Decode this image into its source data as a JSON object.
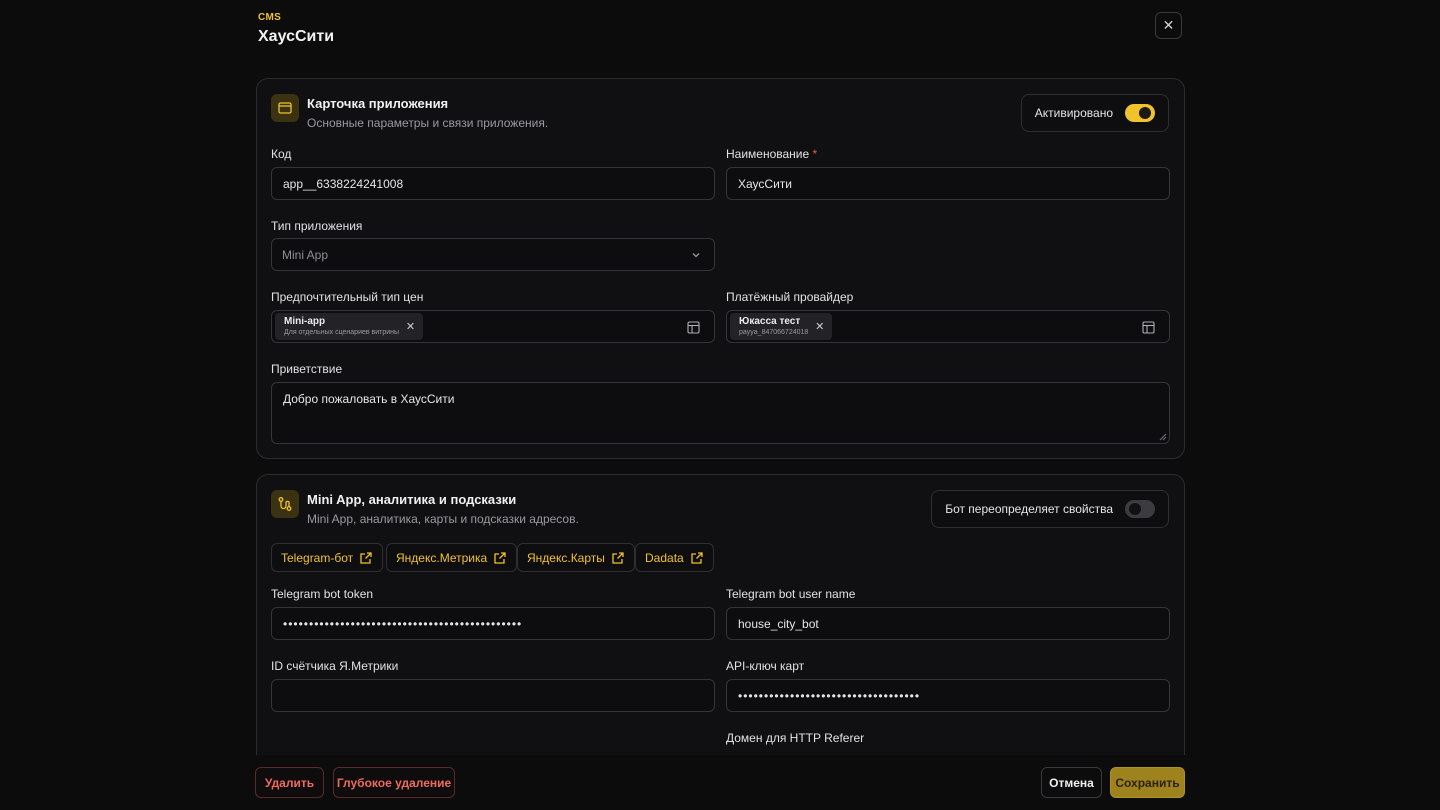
{
  "header": {
    "eyebrow": "CMS",
    "title": "ХаусСити"
  },
  "card1": {
    "title": "Карточка приложения",
    "subtitle": "Основные параметры и связи приложения.",
    "toggle_label": "Активировано",
    "toggle_on": true,
    "code_label": "Код",
    "code_value": "app__6338224241008",
    "name_label": "Наименование",
    "name_required": "*",
    "name_value": "ХаусСити",
    "type_label": "Тип приложения",
    "type_value": "Mini App",
    "price_label": "Предпочтительный тип цен",
    "price_chip_title": "Mini-app",
    "price_chip_sub": "Для отдельных сценариев витрины",
    "provider_label": "Платёжный провайдер",
    "provider_chip_title": "Юкасса тест",
    "provider_chip_sub": "payya_847066724018",
    "greeting_label": "Приветствие",
    "greeting_value": "Добро пожаловать в ХаусСити"
  },
  "card2": {
    "title": "Mini App, аналитика и подсказки",
    "subtitle": "Mini App, аналитика, карты и подсказки адресов.",
    "toggle_label": "Бот переопределяет свойства",
    "toggle_on": false,
    "links": [
      "Telegram-бот",
      "Яндекс.Метрика",
      "Яндекс.Карты",
      "Dadata"
    ],
    "bot_token_label": "Telegram bot token",
    "bot_token_value": "••••••••••••••••••••••••••••••••••••••••••••••",
    "bot_user_label": "Telegram bot user name",
    "bot_user_value": "house_city_bot",
    "metrika_label": "ID счётчика Я.Метрики",
    "metrika_value": "",
    "maps_key_label": "API-ключ карт",
    "maps_key_value": "•••••••••••••••••••••••••••••••••••",
    "referer_label": "Домен для HTTP Referer"
  },
  "footer": {
    "delete": "Удалить",
    "deep_delete": "Глубокое удаление",
    "cancel": "Отмена",
    "save": "Сохранить"
  },
  "colors": {
    "accent": "#f0c22c",
    "danger": "#ee6a60",
    "background": "#0c0c0d"
  }
}
